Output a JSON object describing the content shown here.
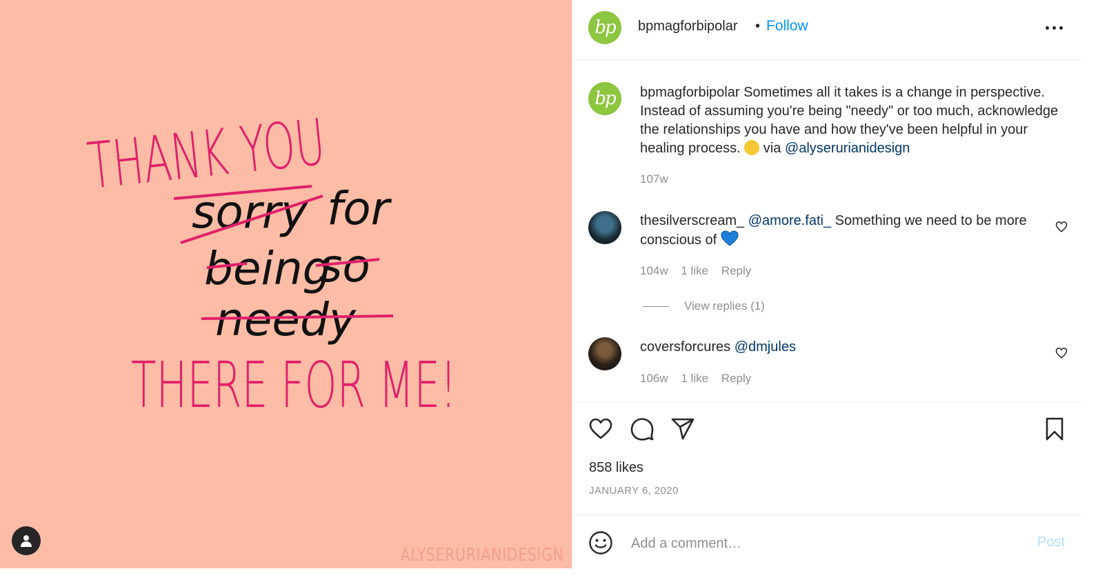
{
  "post_image": {
    "artwork_lines": {
      "thank_you": "THANK YOU",
      "sorry": "sorry",
      "for": "for",
      "being": "being",
      "so": "so",
      "needy": "needy",
      "there_for_me": "THERE FOR ME!"
    },
    "watermark": "ALYSERURIANIDESIGN",
    "tag_icon": "user-tag-icon",
    "colors": {
      "background": "#fdbca5",
      "pink_ink": "#e0206a",
      "black_ink": "#111111"
    }
  },
  "header": {
    "avatar_text": "bp",
    "username": "bpmagforbipolar",
    "separator": "•",
    "follow_label": "Follow",
    "more_icon": "more-options-icon"
  },
  "caption": {
    "username": "bpmagforbipolar",
    "text_1": "Sometimes all it takes is a change in perspective. Instead of assuming you're being \"needy\" or too much, acknowledge the relationships you have and how they've been helpful in your healing process.",
    "text_2": "via",
    "mention": "@alyserurianidesign",
    "time": "107w"
  },
  "comments": [
    {
      "username": "thesilverscream_",
      "mention": "@amore.fati_",
      "text": "Something we need to be more conscious of",
      "time": "104w",
      "likes": "1 like",
      "reply_label": "Reply",
      "view_replies": "View replies (1)"
    },
    {
      "username": "coversforcures",
      "mention": "@dmjules",
      "text": "",
      "time": "106w",
      "likes": "1 like",
      "reply_label": "Reply"
    }
  ],
  "actions": {
    "like_icon": "heart-icon",
    "comment_icon": "comment-icon",
    "share_icon": "share-icon",
    "save_icon": "bookmark-icon"
  },
  "likes_count": "858 likes",
  "post_date": "JANUARY 6, 2020",
  "add_comment": {
    "placeholder": "Add a comment…",
    "post_label": "Post",
    "emoji_icon": "smiley-icon"
  },
  "colors": {
    "accent": "#0095f6",
    "mention": "#00376b",
    "muted": "#8e8e8e",
    "post_disabled": "#b2dffc",
    "avatar_green": "#8dc63f"
  }
}
